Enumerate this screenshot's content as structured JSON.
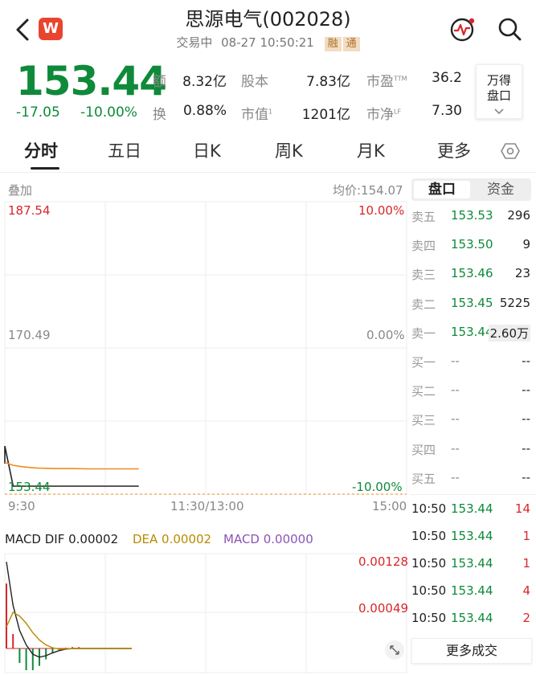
{
  "header": {
    "title": "思源电气(002028)",
    "status": "交易中",
    "datetime": "08-27 10:50:21",
    "badges": [
      "融",
      "通"
    ],
    "logo_letter": "W"
  },
  "quote": {
    "price": "153.44",
    "change": "-17.05",
    "change_pct": "-10.00%",
    "stats": [
      {
        "label": "额",
        "value": "8.32亿"
      },
      {
        "label": "股本",
        "value": "7.83亿"
      },
      {
        "label": "市盈",
        "sup": "TTM",
        "value": "36.2"
      },
      {
        "label": "换",
        "value": "0.88%"
      },
      {
        "label": "市值",
        "sup": "1",
        "value": "1201亿"
      },
      {
        "label": "市净",
        "sup": "LF",
        "value": "7.30"
      }
    ],
    "wind_button": [
      "万得",
      "盘口"
    ]
  },
  "tabs": [
    "分时",
    "五日",
    "日K",
    "周K",
    "月K",
    "更多"
  ],
  "chart": {
    "overlay_label": "叠加",
    "avg_price": "均价:154.07",
    "y_top_price": "187.54",
    "y_mid_price": "170.49",
    "y_bot_price": "153.44",
    "y_top_pct": "10.00%",
    "y_mid_pct": "0.00%",
    "y_bot_pct": "-10.00%",
    "x_labels": [
      "9:30",
      "11:30/13:00",
      "15:00"
    ]
  },
  "chart_data": {
    "type": "line",
    "x": [
      "9:30",
      "9:35",
      "9:40",
      "9:45",
      "9:50",
      "9:55",
      "10:00",
      "10:10",
      "10:20",
      "10:30",
      "10:40",
      "10:50"
    ],
    "series": [
      {
        "values": [
          154.9,
          153.44,
          153.44,
          153.44,
          153.44,
          153.44,
          153.44,
          153.44,
          153.44,
          153.44,
          153.44,
          153.44
        ],
        "color": "#222222"
      },
      {
        "values": [
          154.3,
          154.2,
          154.15,
          154.12,
          154.1,
          154.09,
          154.08,
          154.08,
          154.07,
          154.07,
          154.07,
          154.07
        ],
        "color": "#f08a1c"
      }
    ],
    "ylim": [
      153.44,
      187.54
    ]
  },
  "macd": {
    "label_dif": "MACD DIF 0.00002",
    "label_dea": "DEA 0.00002",
    "label_macd": "MACD 0.00000",
    "y_top": "0.00128",
    "y_mid": "0.00049",
    "dif": [
      0.0012,
      0.0006,
      0.00025,
      5e-05,
      -8e-05,
      -0.00012,
      -0.0001,
      -6e-05,
      -3e-05,
      -1e-05,
      0.0,
      0.0,
      0.0,
      0.0,
      0.0,
      0.0,
      0.0,
      0.0,
      0.0,
      0.0
    ],
    "dea": [
      0.0003,
      0.0005,
      0.00045,
      0.00035,
      0.00022,
      0.00012,
      5e-05,
      1e-05,
      -1e-05,
      -1e-05,
      0.0,
      0.0,
      0.0,
      0.0,
      0.0,
      0.0,
      0.0,
      0.0,
      0.0,
      0.0
    ],
    "hist": [
      0.0009,
      0.0002,
      -0.0002,
      -0.0003,
      -0.0003,
      -0.00024,
      -0.00015,
      -7e-05,
      -2e-05,
      1e-05,
      2e-05,
      2e-05,
      1e-05,
      1e-05,
      0.0,
      0.0,
      0.0,
      0.0,
      0.0,
      0.0
    ],
    "ylim": [
      -0.0003,
      0.00128
    ],
    "colors": {
      "dif": "#222222",
      "dea": "#b88a00",
      "macd": "#8a54b8",
      "up": "#d8262b",
      "down": "#0e8a3a"
    }
  },
  "panel": {
    "tabs": [
      "盘口",
      "资金"
    ],
    "sell": [
      {
        "name": "卖五",
        "price": "153.53",
        "vol": "296"
      },
      {
        "name": "卖四",
        "price": "153.50",
        "vol": "9"
      },
      {
        "name": "卖三",
        "price": "153.46",
        "vol": "23"
      },
      {
        "name": "卖二",
        "price": "153.45",
        "vol": "5225"
      },
      {
        "name": "卖一",
        "price": "153.44",
        "vol": "2.60万"
      }
    ],
    "buy": [
      {
        "name": "买一",
        "price": "--",
        "vol": "--"
      },
      {
        "name": "买二",
        "price": "--",
        "vol": "--"
      },
      {
        "name": "买三",
        "price": "--",
        "vol": "--"
      },
      {
        "name": "买四",
        "price": "--",
        "vol": "--"
      },
      {
        "name": "买五",
        "price": "--",
        "vol": "--"
      }
    ],
    "trades": [
      {
        "time": "10:50",
        "price": "153.44",
        "vol": "14"
      },
      {
        "time": "10:50",
        "price": "153.44",
        "vol": "1"
      },
      {
        "time": "10:50",
        "price": "153.44",
        "vol": "1"
      },
      {
        "time": "10:50",
        "price": "153.44",
        "vol": "4"
      },
      {
        "time": "10:50",
        "price": "153.44",
        "vol": "2"
      }
    ],
    "more_trades": "更多成交"
  },
  "icons": {
    "back": "chevron-left-icon",
    "pulse": "pulse-monitor-icon",
    "search": "search-icon",
    "settings": "hexagon-settings-icon",
    "expand": "expand-icon"
  }
}
